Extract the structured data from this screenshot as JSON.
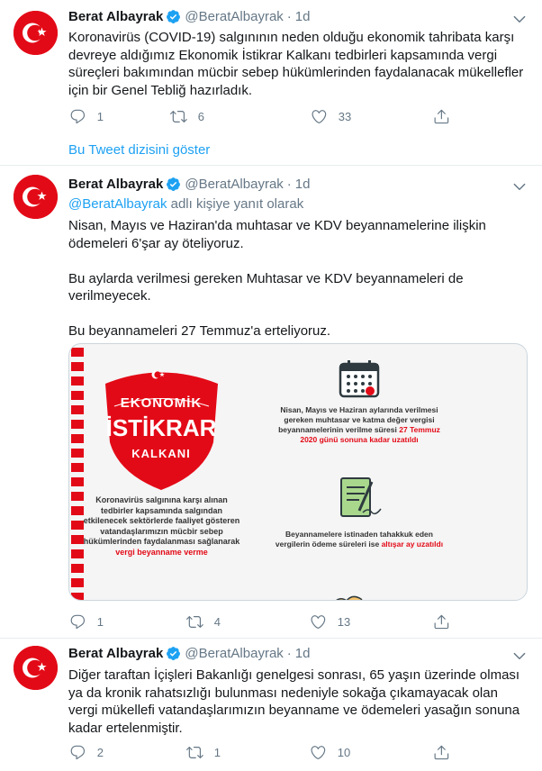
{
  "tweets": [
    {
      "name": "Berat Albayrak",
      "handle": "@BeratAlbayrak",
      "dot": "·",
      "time": "1d",
      "text": "Koronavirüs (COVID-19) salgınının neden olduğu ekonomik tahribata karşı devreye aldığımız Ekonomik İstikrar Kalkanı tedbirleri kapsamında vergi süreçleri bakımından mücbir sebep hükümlerinden faydalanacak mükellefler için bir Genel Tebliğ hazırladık.",
      "replies": "1",
      "retweets": "6",
      "likes": "33"
    },
    {
      "name": "Berat Albayrak",
      "handle": "@BeratAlbayrak",
      "dot": "·",
      "time": "1d",
      "replying_mention": "@BeratAlbayrak",
      "replying_suffix": " adlı kişiye yanıt olarak",
      "text_p1": "Nisan, Mayıs ve Haziran'da muhtasar ve KDV beyannamelerine ilişkin ödemeleri 6'şar ay öteliyoruz.",
      "text_p2": "Bu aylarda verilmesi gereken Muhtasar ve KDV beyannameleri de verilmeyecek.",
      "text_p3": "Bu beyannameleri 27 Temmuz'a erteliyoruz.",
      "replies": "1",
      "retweets": "4",
      "likes": "13"
    },
    {
      "name": "Berat Albayrak",
      "handle": "@BeratAlbayrak",
      "dot": "·",
      "time": "1d",
      "text": "Diğer taraftan İçişleri Bakanlığı genelgesi sonrası, 65 yaşın üzerinde olması ya da kronik rahatsızlığı bulunması nedeniyle sokağa çıkamayacak olan vergi mükellefi vatandaşlarımızın beyanname ve ödemeleri yasağın sonuna kadar ertelenmiştir.",
      "replies": "2",
      "retweets": "1",
      "likes": "10"
    }
  ],
  "show_thread": "Bu Tweet dizisini göster",
  "media": {
    "logo_top": "EKONOMİK",
    "logo_main": "İSTİKRAR",
    "logo_bottom": "KALKANI",
    "left_text": "Koronavirüs salgınına karşı alınan tedbirler kapsamında salgından etkilenecek sektörlerde faaliyet gösteren vatandaşlarımızın mücbir sebep hükümlerinden faydalanması sağlanarak",
    "left_red": "vergi beyanname verme",
    "right1_text": "Nisan, Mayıs ve Haziran aylarında verilmesi gereken muhtasar ve katma değer vergisi beyannamelerinin verilme süresi",
    "right1_red": "27 Temmuz 2020 günü sonuna kadar uzatıldı",
    "right2_text": "Beyannamelere istinaden tahakkuk eden vergilerin ödeme süreleri ise",
    "right2_red": "altışar ay uzatıldı"
  },
  "colors": {
    "accent": "#1da1f2",
    "muted": "#657786",
    "brand_red": "#e30a17"
  }
}
